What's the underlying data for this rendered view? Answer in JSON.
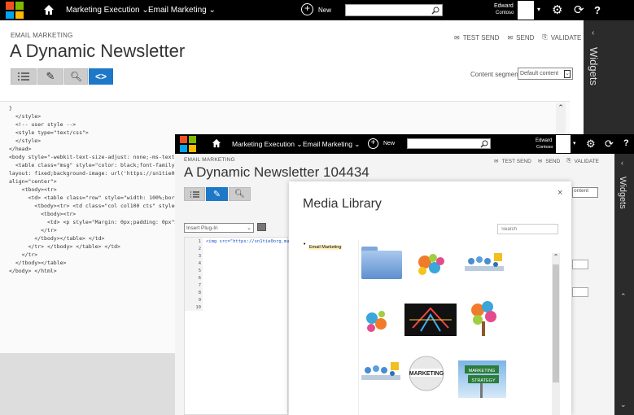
{
  "back": {
    "nav": {
      "home_icon": "home-icon",
      "item1": "Marketing Execution ⌄",
      "item2": "Email Marketing ⌄",
      "new_label": "New",
      "user_name": "Edward",
      "user_org": "Contoso"
    },
    "breadcrumb": "EMAIL MARKETING",
    "title": "A Dynamic Newsletter",
    "actions": {
      "test_send": "TEST SEND",
      "send": "SEND",
      "validate": "VALIDATE"
    },
    "content_segment_label": "Content segment",
    "content_segment_value": "Default content",
    "widgets": "Widgets",
    "code": [
      "}",
      "  </style>",
      "",
      "  <!-- user style -->",
      "  <style type=\"text/css\">",
      "",
      "  </style>",
      "</head>",
      "",
      "<body style=\"-webkit-text-size-adjust: none;-ms-text-size-adju",
      "  <table class=\"msg\" style=\"color: black;font-family: Arial, Helv",
      "layout: fixed;background-image: url('https://sn1tie0org.marketi",
      "align=\"center\">",
      "    <tbody><tr>",
      "      <td> <table class=\"row\" style=\"width: 100%;border-collaps",
      "        <tbody><tr> <td class=\"col col100 cts\" style=\"display: tab",
      "          <tbody><tr>",
      "            <td> <p style=\"Margin: 0px;padding: 0px\"><font color",
      "          </tr>",
      "        </tbody></table> </td>",
      "      </tr> </tbody> </table> </td>",
      "    </tr>",
      "  </tbody></table>",
      "",
      "</body> </html>"
    ]
  },
  "front": {
    "breadcrumb": "EMAIL MARKETING",
    "title": "A Dynamic Newsletter 104434",
    "nav": {
      "item1": "Marketing Execution ⌄",
      "item2": "Email Marketing ⌄",
      "new_label": "New",
      "user_name": "Edward",
      "user_org": "Contoso"
    },
    "actions": {
      "test_send": "TEST SEND",
      "send": "SEND",
      "validate": "VALIDATE"
    },
    "widgets": "Widgets",
    "content_fragment": "ontent",
    "insert_plugin": "Insert Plug-In",
    "code_line1": "<img src=\"https://sn1tie0org.market",
    "line_numbers": [
      "1",
      "2",
      "3",
      "4",
      "5",
      "6",
      "7",
      "8",
      "9",
      "10"
    ]
  },
  "media_library": {
    "title": "Media Library",
    "search_placeholder": "Search",
    "tree_item": "Email Marketing",
    "close": "×",
    "thumbnails": [
      "folder",
      "gears-colorful",
      "people-meeting",
      "gears-colorful-2",
      "word-cloud-dark",
      "tree-colorful",
      "people-meeting-2",
      "marketing-sphere",
      "marketing-strategy-sign"
    ]
  }
}
